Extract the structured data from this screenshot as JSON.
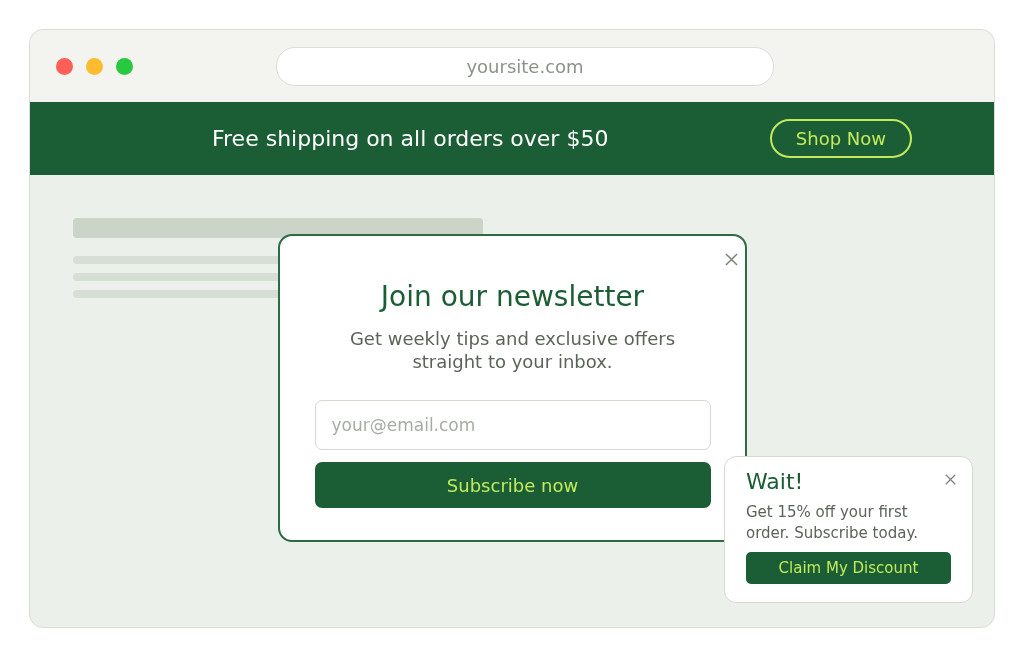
{
  "browser": {
    "url": "yoursite.com"
  },
  "banner": {
    "text": "Free shipping on all orders over $50",
    "button": "Shop Now"
  },
  "newsletter": {
    "title": "Join our newsletter",
    "description": "Get weekly tips and exclusive offers straight to your inbox.",
    "email": {
      "placeholder": "your@email.com"
    },
    "button": "Subscribe now"
  },
  "toast": {
    "title": "Wait!",
    "text": "Get 15% off your first order. Subscribe today.",
    "button": "Claim My Discount"
  }
}
